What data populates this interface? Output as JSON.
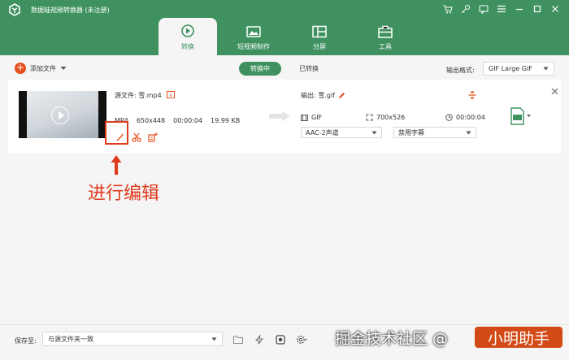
{
  "app": {
    "title": "数据蛙视频转换器 (未注册)"
  },
  "tabs": [
    {
      "label": "转换",
      "active": true
    },
    {
      "label": "短视频制作",
      "active": false
    },
    {
      "label": "分屏",
      "active": false
    },
    {
      "label": "工具",
      "active": false
    }
  ],
  "toolbar": {
    "add_file_label": "添加文件",
    "segment": {
      "converting": "转换中",
      "converted": "已转换"
    },
    "output_format_label": "输出格式:",
    "output_format_value": "GIF Large GIF"
  },
  "file": {
    "source_label": "源文件: 雪.mp4",
    "format": "MP4",
    "resolution": "650x448",
    "duration": "00:00:04",
    "size": "19.99 KB",
    "output_label": "输出: 雪.gif",
    "out_format": "GIF",
    "out_resolution": "700x526",
    "out_duration": "00:00:04",
    "audio_track": "AAC-2声道",
    "subtitle": "禁用字幕"
  },
  "annotation": {
    "text": "进行编辑"
  },
  "bottom": {
    "save_label": "保存至:",
    "save_path": "与源文件夹一致"
  },
  "watermark": {
    "left": "掘金技术社区 @",
    "badge": "小明助手"
  },
  "colors": {
    "brand_green": "#3f9260",
    "accent_orange": "#e84f1f",
    "annotation_red": "#e03a1e"
  }
}
